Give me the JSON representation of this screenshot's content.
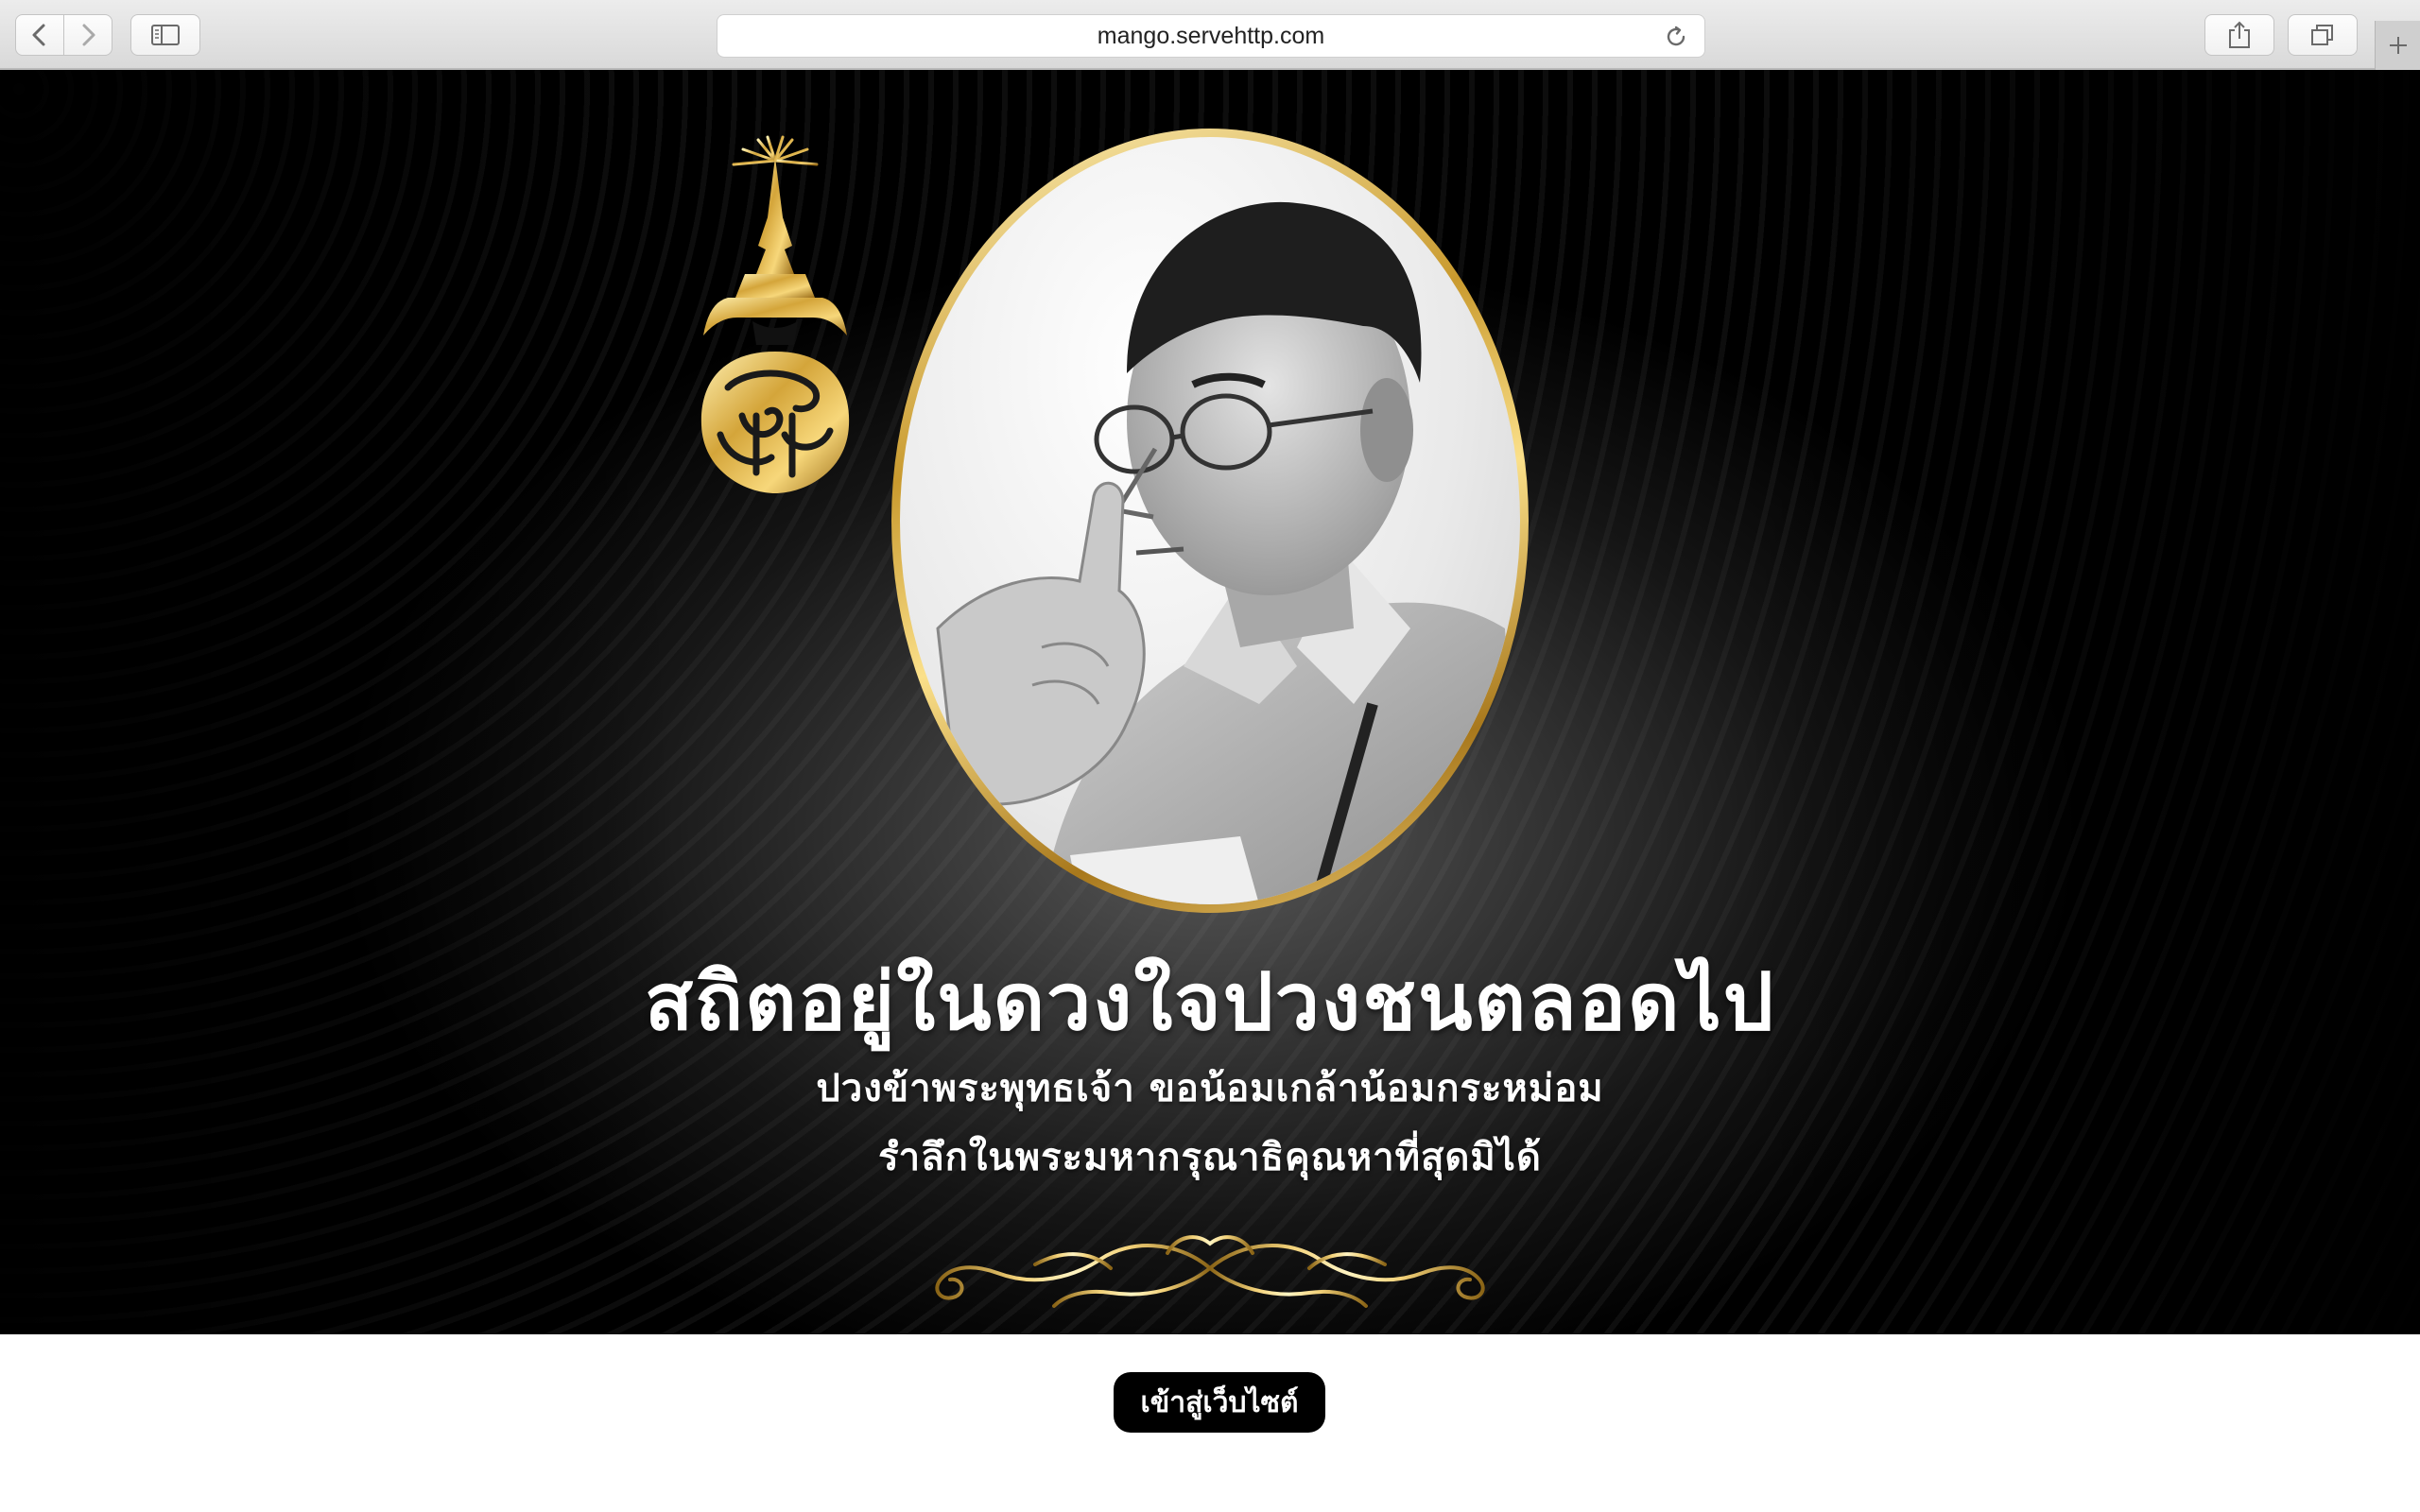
{
  "browser": {
    "url": "mango.servehttp.com",
    "icons": {
      "back": "chevron-left-icon",
      "forward": "chevron-right-icon",
      "sidebar": "sidebar-icon",
      "reload": "reload-icon",
      "share": "share-icon",
      "tabs": "tabs-overview-icon",
      "new_tab": "plus-icon"
    }
  },
  "banner": {
    "headline": "สถิตอยู่ในดวงใจปวงชนตลอดไป",
    "line1": "ปวงข้าพระพุทธเจ้า ขอน้อมเกล้าน้อมกระหม่อม",
    "line2": "รำลึกในพระมหากรุณาธิคุณหาที่สุดมิได้",
    "colors": {
      "gold": "#d4a53a",
      "text": "#ffffff",
      "background": "#000000"
    }
  },
  "enter_button": {
    "label": "เข้าสู่เว็บไซต์"
  }
}
